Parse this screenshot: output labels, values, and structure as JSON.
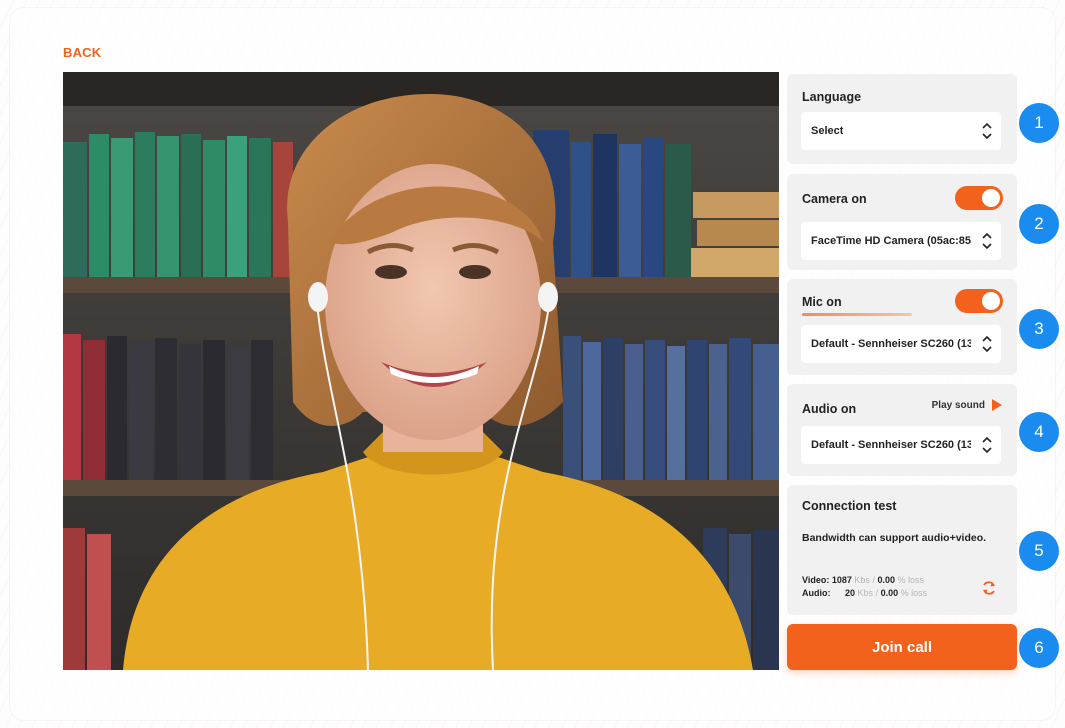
{
  "nav": {
    "back_label": "BACK"
  },
  "language": {
    "title": "Language",
    "value": "Select"
  },
  "camera": {
    "title": "Camera on",
    "enabled": true,
    "device": "FaceTime HD Camera (05ac:85"
  },
  "mic": {
    "title": "Mic on",
    "enabled": true,
    "device": "Default - Sennheiser SC260 (13"
  },
  "audio": {
    "title": "Audio on",
    "play_sound_label": "Play sound",
    "device": "Default - Sennheiser SC260 (13"
  },
  "connection": {
    "title": "Connection test",
    "message": "Bandwidth can support audio+video.",
    "video_label": "Video:",
    "video_kbs": "1087",
    "video_loss": "0.00",
    "audio_label": "Audio:",
    "audio_kbs": "20",
    "audio_loss": "0.00",
    "kbs_unit": "Kbs /",
    "loss_unit": "% loss"
  },
  "join_label": "Join call",
  "badges": [
    "1",
    "2",
    "3",
    "4",
    "5",
    "6"
  ],
  "colors": {
    "accent": "#f2621c",
    "badge": "#1a8cf0",
    "panel": "#f1f1f1"
  }
}
